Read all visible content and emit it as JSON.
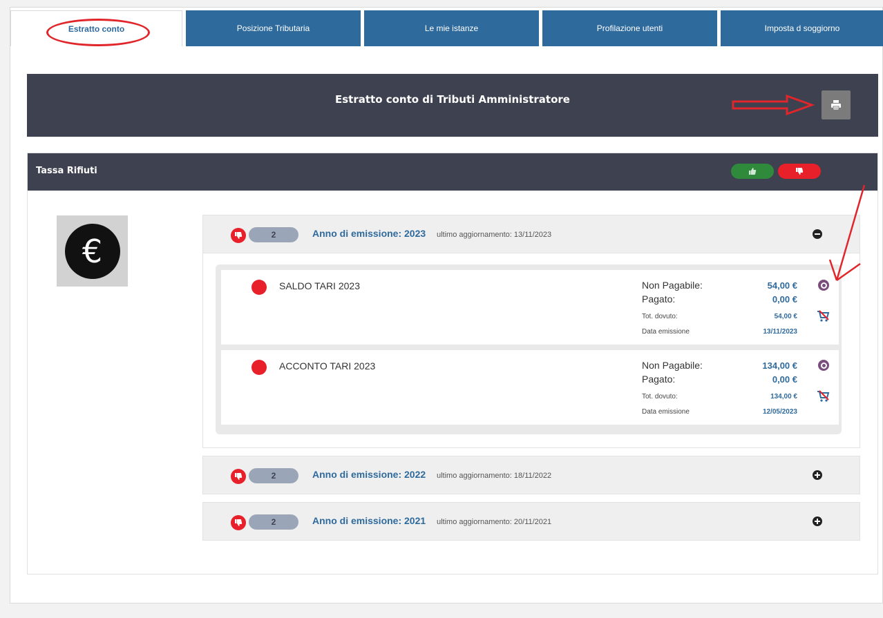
{
  "tabs": [
    {
      "label": "Estratto conto",
      "active": true
    },
    {
      "label": "Posizione Tributaria",
      "active": false
    },
    {
      "label": "Le mie istanze",
      "active": false
    },
    {
      "label": "Profilazione utenti",
      "active": false
    },
    {
      "label": "Imposta d soggiorno",
      "active": false
    }
  ],
  "header": {
    "title": "Estratto conto di Tributi Amministratore",
    "print_icon": "printer-icon"
  },
  "section": {
    "title": "Tassa Rifiuti",
    "positive_icon": "thumbs-up-icon",
    "negative_icon": "thumbs-down-icon"
  },
  "years": [
    {
      "count": "2",
      "label": "Anno di emissione: 2023",
      "update": "ultimo aggiornamento: 13/11/2023",
      "expanded": true,
      "items": [
        {
          "title": "SALDO TARI 2023",
          "k1": "Non Pagabile:",
          "v1": "54,00 €",
          "k2": "Pagato:",
          "v2": "0,00 €",
          "k3": "Tot. dovuto:",
          "v3": "54,00 €",
          "k4": "Data emissione",
          "v4": "13/11/2023"
        },
        {
          "title": "ACCONTO TARI 2023",
          "k1": "Non Pagabile:",
          "v1": "134,00 €",
          "k2": "Pagato:",
          "v2": "0,00 €",
          "k3": "Tot. dovuto:",
          "v3": "134,00 €",
          "k4": "Data emissione",
          "v4": "12/05/2023"
        }
      ]
    },
    {
      "count": "2",
      "label": "Anno di emissione: 2022",
      "update": "ultimo aggiornamento: 18/11/2022",
      "expanded": false
    },
    {
      "count": "2",
      "label": "Anno di emissione: 2021",
      "update": "ultimo aggiornamento: 20/11/2021",
      "expanded": false
    }
  ],
  "colors": {
    "accent": "#2f6a9d",
    "header_bg": "#3d4150",
    "red": "#e8202a",
    "green": "#2f8a3c",
    "annotation": "#e0262b"
  }
}
